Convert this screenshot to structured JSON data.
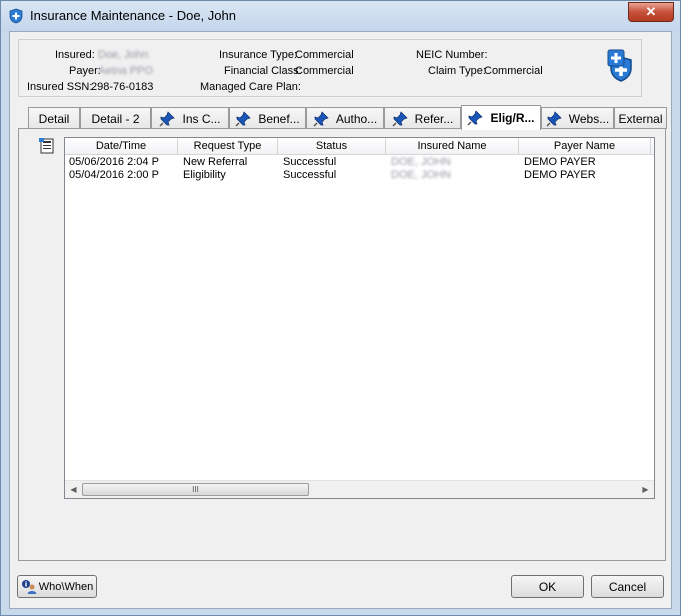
{
  "window": {
    "title": "Insurance Maintenance - Doe, John",
    "close_label": "✕"
  },
  "header": {
    "insured_label": "Insured:",
    "insured_value": "Doe, John",
    "payer_label": "Payer:",
    "payer_value": "Aetna PPO",
    "ssn_label": "Insured SSN:",
    "ssn_value": "298-76-0183",
    "insurance_type_label": "Insurance Type:",
    "insurance_type_value": "Commercial",
    "financial_class_label": "Financial Class:",
    "financial_class_value": "Commercial",
    "managed_care_label": "Managed Care Plan:",
    "managed_care_value": "",
    "neic_label": "NEIC Number:",
    "neic_value": "",
    "claim_type_label": "Claim Type:",
    "claim_type_value": "Commercial"
  },
  "tabs": [
    {
      "label": "Detail",
      "pinned": false,
      "active": false
    },
    {
      "label": "Detail - 2",
      "pinned": false,
      "active": false
    },
    {
      "label": "Ins C...",
      "pinned": true,
      "active": false
    },
    {
      "label": "Benef...",
      "pinned": true,
      "active": false
    },
    {
      "label": "Autho...",
      "pinned": true,
      "active": false
    },
    {
      "label": "Refer...",
      "pinned": true,
      "active": false
    },
    {
      "label": "Elig/R...",
      "pinned": true,
      "active": true
    },
    {
      "label": "Webs...",
      "pinned": true,
      "active": false
    },
    {
      "label": "External",
      "pinned": false,
      "active": false
    }
  ],
  "grid": {
    "columns": [
      "Date/Time",
      "Request Type",
      "Status",
      "Insured Name",
      "Payer Name"
    ],
    "rows": [
      [
        "05/06/2016 2:04 P",
        "New Referral",
        "Successful",
        "DOE, JOHN",
        "DEMO PAYER"
      ],
      [
        "05/04/2016 2:00 P",
        "Eligibility",
        "Successful",
        "DOE, JOHN",
        "DEMO PAYER"
      ]
    ],
    "scroll_thumb_grip": "III",
    "scroll_left": "◀",
    "scroll_right": "▶"
  },
  "buttons": {
    "whowhen": "Who\\When",
    "ok": "OK",
    "cancel": "Cancel"
  },
  "colors": {
    "accent": "#1e73be",
    "shield": "#2b7bd6",
    "pin": "#1a56b8"
  }
}
